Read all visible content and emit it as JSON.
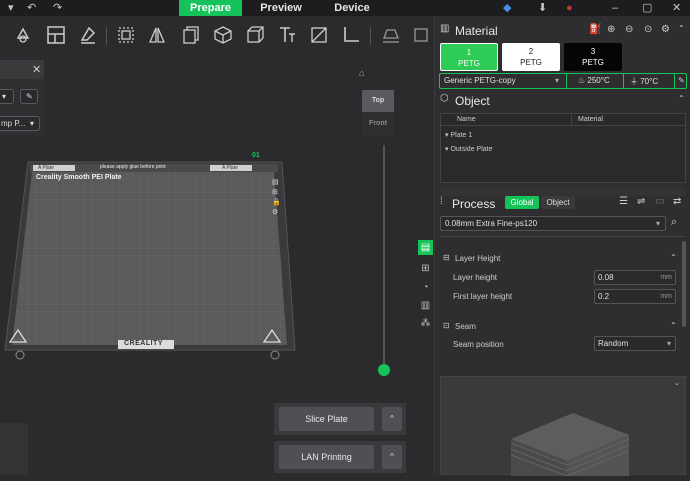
{
  "topbar": {
    "tabs": [
      {
        "label": "Prepare",
        "active": true
      },
      {
        "label": "Preview",
        "active": false
      },
      {
        "label": "Device",
        "active": false
      }
    ],
    "icons": [
      "undo-icon",
      "redo-icon",
      "cube-icon",
      "download-icon",
      "user-icon",
      "minimize-icon",
      "maximize-icon",
      "close-icon"
    ]
  },
  "left_panel": {
    "field_text": "mp P..."
  },
  "viewport": {
    "plate_label": "Creality Smooth PEI Plate",
    "plate_tab_left": "A Plate",
    "plate_tab_center": "please apply glue before print",
    "plate_tab_right": "A Plate",
    "plate_number": "01",
    "brand": "CREALITY",
    "view_top": "Top",
    "view_front": "Front"
  },
  "buttons": {
    "slice": "Slice Plate",
    "print": "LAN Printing",
    "arrow": "^"
  },
  "material": {
    "title": "Material",
    "filaments": [
      {
        "num": "1",
        "name": "PETG",
        "bg": "#2ecc56",
        "fg": "#ffffff"
      },
      {
        "num": "2",
        "name": "PETG",
        "bg": "#ffffff",
        "fg": "#222222"
      },
      {
        "num": "3",
        "name": "PETG",
        "bg": "#050505",
        "fg": "#ffffff"
      }
    ],
    "profile": "Generic PETG-copy",
    "nozzle_temp": "250°C",
    "bed_temp": "70°C"
  },
  "object": {
    "title": "Object",
    "col_name": "Name",
    "col_material": "Material",
    "items": [
      "Plate 1",
      "Outside Plate"
    ]
  },
  "process": {
    "title": "Process",
    "tab_global": "Global",
    "tab_object": "Object",
    "preset": "0.08mm Extra Fine-ps120",
    "layer_height_section": "Layer Height",
    "layer_height_label": "Layer height",
    "layer_height_value": "0.08",
    "first_layer_label": "First layer height",
    "first_layer_value": "0.2",
    "unit": "mm",
    "seam_section": "Seam",
    "seam_label": "Seam position",
    "seam_value": "Random"
  },
  "colors": {
    "accent": "#16c35a",
    "background": "#2b2b2e",
    "panel": "#2e2e31"
  }
}
